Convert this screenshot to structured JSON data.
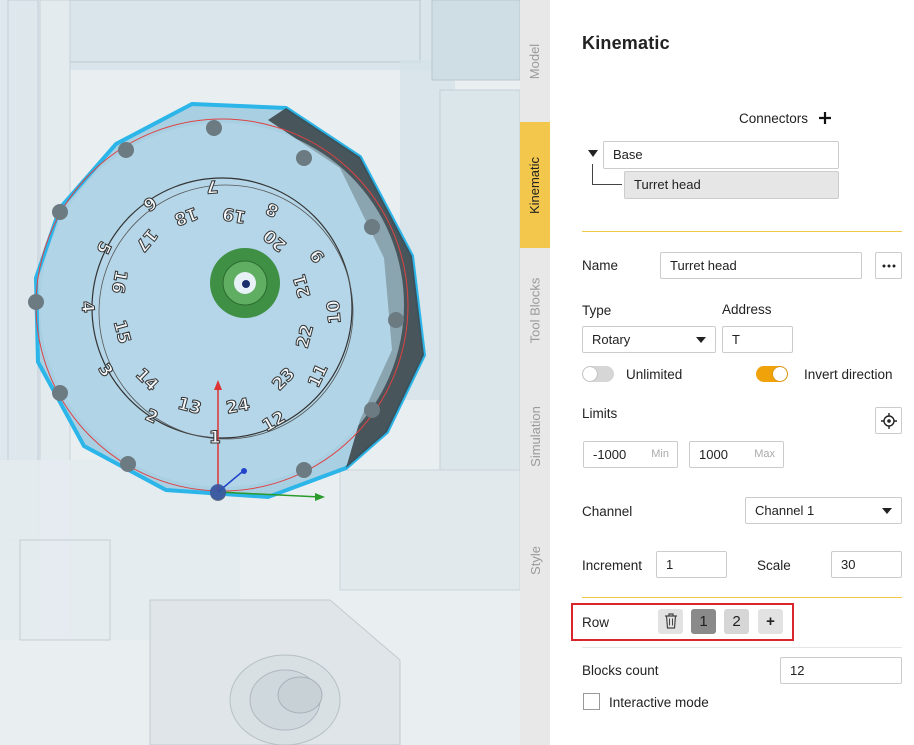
{
  "viewport": {
    "dial_numbers": [
      "1",
      "2",
      "3",
      "4",
      "5",
      "6",
      "7",
      "8",
      "9",
      "10",
      "11",
      "12",
      "13",
      "14",
      "15",
      "16",
      "17",
      "18",
      "19",
      "20",
      "21",
      "22",
      "23",
      "24"
    ]
  },
  "tabs": [
    {
      "label": "Model",
      "active": false
    },
    {
      "label": "Kinematic",
      "active": true
    },
    {
      "label": "Tool Blocks",
      "active": false
    },
    {
      "label": "Simulation",
      "active": false
    },
    {
      "label": "Style",
      "active": false
    }
  ],
  "panel": {
    "title": "Kinematic",
    "connectors": {
      "label": "Connectors",
      "add_icon": "plus-icon",
      "tree": [
        {
          "label": "Base",
          "expanded": true
        },
        {
          "label": "Turret head",
          "selected": true
        }
      ]
    },
    "name": {
      "label": "Name",
      "value": "Turret head",
      "more_icon": "ellipsis-icon"
    },
    "type": {
      "label": "Type",
      "value": "Rotary"
    },
    "address": {
      "label": "Address",
      "value": "T"
    },
    "unlimited": {
      "label": "Unlimited",
      "on": false
    },
    "invert": {
      "label": "Invert direction",
      "on": true
    },
    "limits": {
      "label": "Limits",
      "min": "-1000",
      "min_hint": "Min",
      "max": "1000",
      "max_hint": "Max",
      "target_icon": "crosshair-icon"
    },
    "channel": {
      "label": "Channel",
      "value": "Channel 1"
    },
    "increment": {
      "label": "Increment",
      "value": "1"
    },
    "scale": {
      "label": "Scale",
      "value": "30"
    },
    "row": {
      "label": "Row",
      "delete_icon": "trash-icon",
      "items": [
        "1",
        "2"
      ],
      "add": "+"
    },
    "blocks_count": {
      "label": "Blocks count",
      "value": "12"
    },
    "interactive": {
      "label": "Interactive mode",
      "checked": false
    }
  },
  "colors": {
    "accent": "#f3c74b",
    "toggle_on": "#f0a20a",
    "highlight_box": "#d9262c",
    "selection_outline": "#2bb5e8"
  }
}
